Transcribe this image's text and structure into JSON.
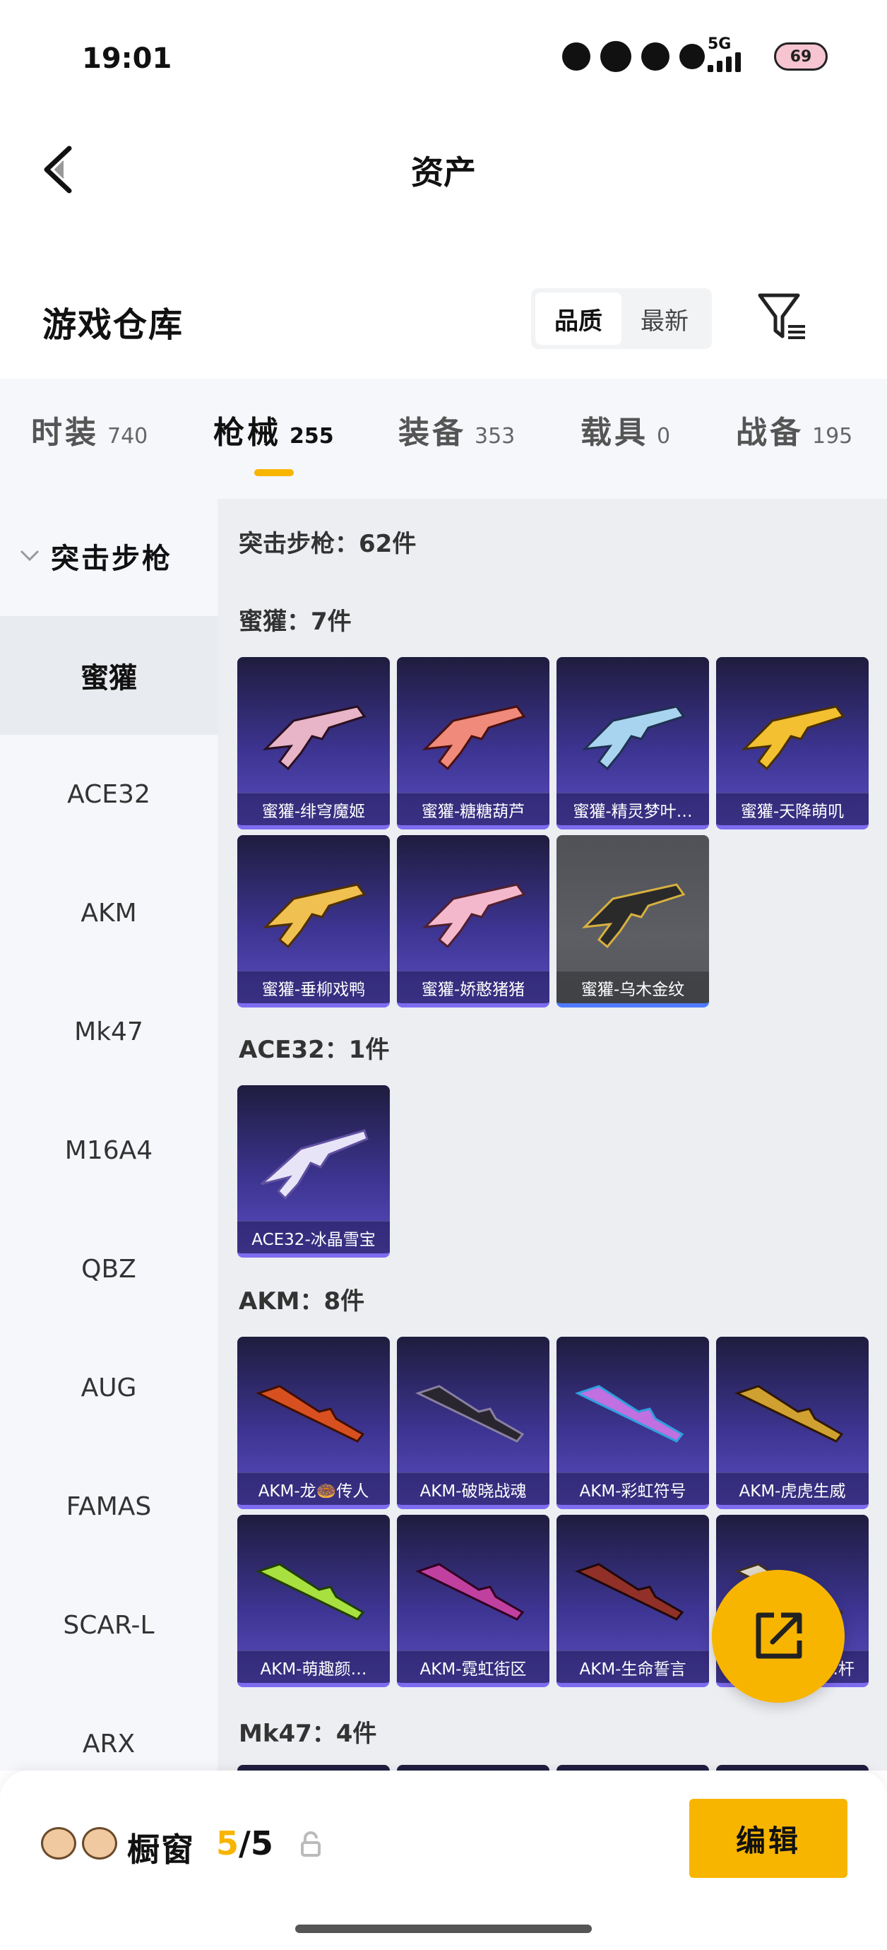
{
  "status": {
    "time": "19:01",
    "network": "5G",
    "battery": "69"
  },
  "header": {
    "title": "资产"
  },
  "warehouse": {
    "title": "游戏仓库",
    "sort": [
      "品质",
      "最新"
    ]
  },
  "categories": [
    {
      "name": "时装",
      "count": "740"
    },
    {
      "name": "枪械",
      "count": "255"
    },
    {
      "name": "装备",
      "count": "353"
    },
    {
      "name": "载具",
      "count": "0"
    },
    {
      "name": "战备",
      "count": "195"
    }
  ],
  "sidebar": {
    "group": "突击步枪",
    "items": [
      "蜜獾",
      "ACE32",
      "AKM",
      "Mk47",
      "M16A4",
      "QBZ",
      "AUG",
      "FAMAS",
      "SCAR-L",
      "ARX"
    ]
  },
  "content": {
    "summary": "突击步枪：62件",
    "sections": [
      {
        "label": "蜜獾：7件",
        "items": [
          "蜜獾-绯穹魔姬",
          "蜜獾-糖糖葫芦",
          "蜜獾-精灵梦叶…",
          "蜜獾-天降萌叽",
          "蜜獾-垂柳戏鸭",
          "蜜獾-娇憨猪猪",
          "蜜獾-乌木金纹"
        ]
      },
      {
        "label": "ACE32：1件",
        "items": [
          "ACE32-冰晶雪宝"
        ]
      },
      {
        "label": "AKM：8件",
        "items": [
          "AKM-龙🍩传人",
          "AKM-破晓战魂",
          "AKM-彩虹符号",
          "AKM-虎虎生威",
          "AKM-萌趣颜…",
          "AKM-霓虹街区",
          "AKM-生命誓言",
          "AKM-…杆"
        ]
      },
      {
        "label": "Mk47：4件",
        "items": []
      }
    ]
  },
  "bottom": {
    "label": "橱窗",
    "current": "5",
    "sep": "/",
    "total": "5",
    "edit": "编辑"
  },
  "colors": {
    "accent": "#f7b500",
    "card_top": "#1f1c3e",
    "card_bottom": "#5a4cc0"
  }
}
